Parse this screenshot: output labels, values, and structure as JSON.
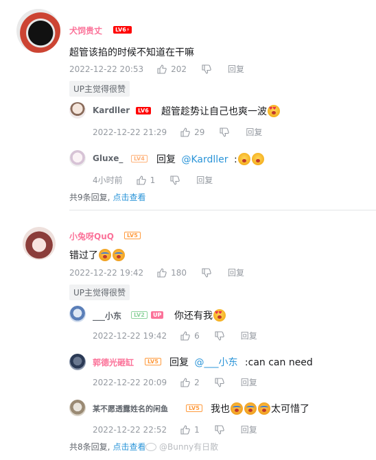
{
  "comments": [
    {
      "username": "犬饲贵丈",
      "level": "LV6⚡",
      "text": "超管该掐的时候不知道在干嘛",
      "date": "2022-12-22 20:53",
      "likes": "202",
      "reply_label": "回复",
      "up_tag": "UP主觉得很赞",
      "replies": [
        {
          "username": "Kardller",
          "level": "LV6",
          "text": "超管趁势让自己也爽一波",
          "date": "2022-12-22 21:29",
          "likes": "29",
          "reply_label": "回复"
        },
        {
          "username": "Gluxe_",
          "level": "LV4",
          "prefix": "回复",
          "mention": "@Kardller",
          "text": ":",
          "date": "4小时前",
          "likes": "1",
          "reply_label": "回复"
        }
      ],
      "summary_count": "共9条回复,",
      "summary_link": "点击查看"
    },
    {
      "username": "小兔呀QuQ",
      "level": "LV5",
      "text": "错过了",
      "date": "2022-12-22 19:42",
      "likes": "180",
      "reply_label": "回复",
      "up_tag": "UP主觉得很赞",
      "replies": [
        {
          "username": "___小东",
          "level": "LV2",
          "up_badge": "UP",
          "text": "你还有我",
          "date": "2022-12-22 19:42",
          "likes": "6",
          "reply_label": "回复"
        },
        {
          "username": "郭德光砸缸",
          "level": "LV5",
          "prefix": "回复",
          "mention": "@___小东",
          "text": ":can can need",
          "date": "2022-12-22 20:09",
          "likes": "2",
          "reply_label": "回复"
        },
        {
          "username": "某不愿透露姓名的闲鱼",
          "level": "LV5",
          "text": "我也",
          "text_after": "太可惜了",
          "date": "2022-12-22 22:52",
          "likes": "1",
          "reply_label": "回复"
        }
      ],
      "summary_count": "共8条回复,",
      "summary_link": "点击查看"
    }
  ],
  "watermark": "@Bunny有日散",
  "colors": {
    "username_pink": "#fb7299",
    "link_blue": "#2a94d8",
    "lv6": "#ff0000",
    "lv5": "#ff9a3c",
    "lv4": "#ffb27a",
    "lv2": "#8bd29b",
    "up_badge": "#fb7299"
  }
}
